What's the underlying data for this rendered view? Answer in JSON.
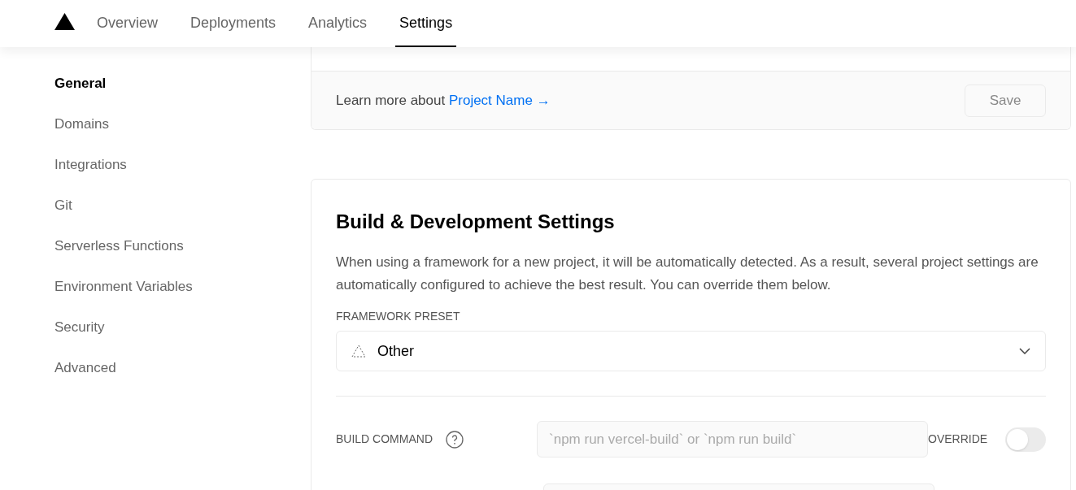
{
  "nav": {
    "tabs": [
      {
        "label": "Overview",
        "selected": false
      },
      {
        "label": "Deployments",
        "selected": false
      },
      {
        "label": "Analytics",
        "selected": false
      },
      {
        "label": "Settings",
        "selected": true
      }
    ]
  },
  "sidebar": {
    "items": [
      {
        "label": "General",
        "selected": true
      },
      {
        "label": "Domains",
        "selected": false
      },
      {
        "label": "Integrations",
        "selected": false
      },
      {
        "label": "Git",
        "selected": false
      },
      {
        "label": "Serverless Functions",
        "selected": false
      },
      {
        "label": "Environment Variables",
        "selected": false
      },
      {
        "label": "Security",
        "selected": false
      },
      {
        "label": "Advanced",
        "selected": false
      }
    ]
  },
  "project_name_card": {
    "footer_text": "Learn more about",
    "link": "Project Name →",
    "save_button": {
      "label": "Save",
      "disabled": true
    }
  },
  "build_card": {
    "title": "Build & Development Settings",
    "description": "When using a framework for a new project, it will be automatically detected. As a result, several project settings are automatically configured to achieve the best result. You can override them below.",
    "framework_label": "FRAMEWORK PRESET",
    "framework_value": "Other",
    "fields": [
      {
        "label": "BUILD COMMAND",
        "placeholder": "`npm run vercel-build` or `npm run build`",
        "override_label": "OVERRIDE",
        "on": false
      }
    ]
  }
}
